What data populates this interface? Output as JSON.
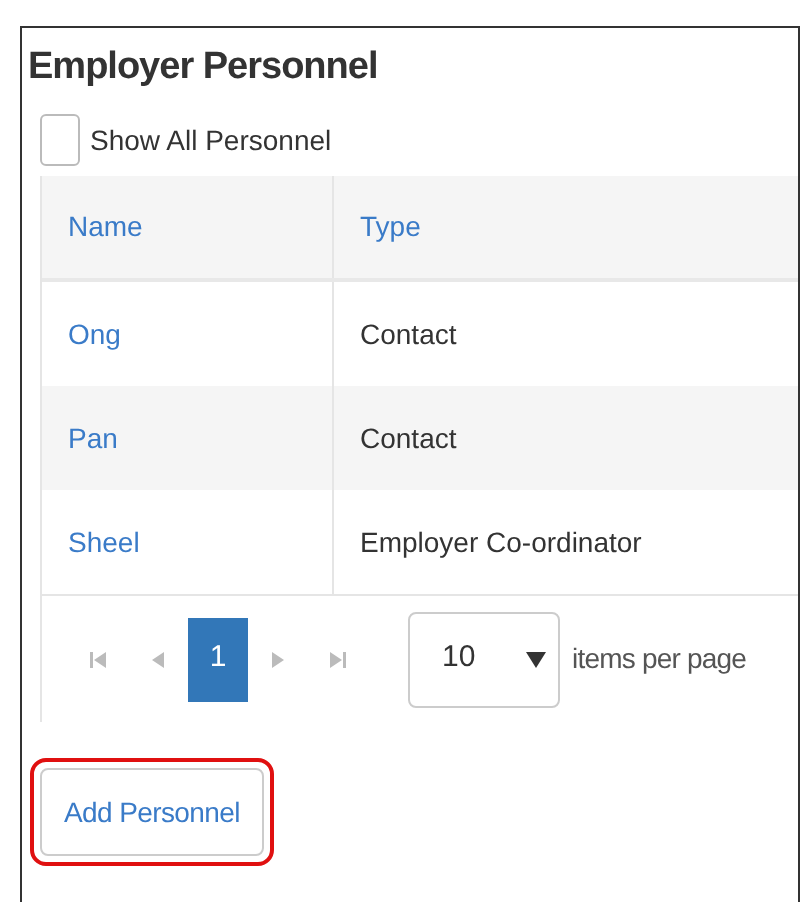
{
  "title": "Employer Personnel",
  "show_all": {
    "label": "Show All Personnel",
    "checked": false
  },
  "table": {
    "columns": [
      "Name",
      "Type"
    ],
    "rows": [
      {
        "name": "Ong",
        "type": "Contact"
      },
      {
        "name": "Pan",
        "type": "Contact"
      },
      {
        "name": "Sheel",
        "type": "Employer Co-ordinator"
      }
    ]
  },
  "pager": {
    "pages": [
      {
        "label": "1",
        "selected": true
      }
    ],
    "page_size": "10",
    "page_size_label": "items per page"
  },
  "add_button": {
    "label": "Add Personnel",
    "highlighted": true
  }
}
